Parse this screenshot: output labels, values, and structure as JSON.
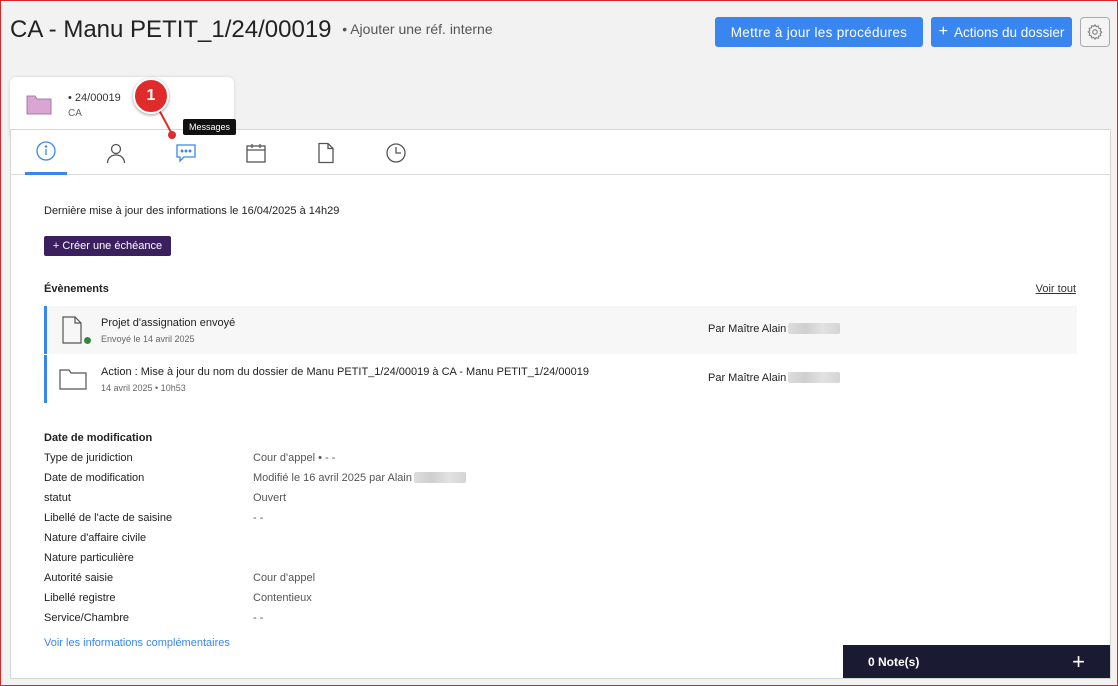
{
  "header": {
    "title": "CA - Manu PETIT_1/24/00019",
    "ref_link": "• Ajouter une réf. interne",
    "update_button": "Mettre à jour les procédures",
    "actions_button": "Actions du dossier",
    "actions_plus": "+"
  },
  "file_tab": {
    "number": "• 24/00019",
    "sub": "CA",
    "folder_color": "#d9a5d2"
  },
  "annotation": {
    "number": "1",
    "color": "#e02b2b"
  },
  "tooltip": {
    "text": "Messages"
  },
  "tabs": [
    {
      "icon": "info-icon",
      "active": true
    },
    {
      "icon": "person-icon"
    },
    {
      "icon": "message-icon"
    },
    {
      "icon": "calendar-icon"
    },
    {
      "icon": "document-icon"
    },
    {
      "icon": "clock-icon"
    }
  ],
  "info": {
    "last_update": "Dernière mise à jour des informations le 16/04/2025 à 14h29",
    "create_button": "+ Créer une échéance"
  },
  "events": {
    "title": "Évènements",
    "see_all": "Voir tout",
    "items": [
      {
        "icon": "document-icon",
        "title": "Projet d'assignation envoyé",
        "subtitle": "Envoyé le 14 avril 2025",
        "by": "Par Maître Alain"
      },
      {
        "icon": "folder-icon",
        "title": "Action : Mise à jour du nom du dossier de Manu PETIT_1/24/00019 à CA - Manu PETIT_1/24/00019",
        "subtitle": "14 avril 2025 • 10h53",
        "by": "Par Maître Alain"
      }
    ]
  },
  "modification": {
    "title": "Date de modification",
    "rows": [
      {
        "key": "Type de juridiction",
        "value": "Cour d'appel • - -"
      },
      {
        "key": "Date de modification",
        "value": "Modifié le 16 avril 2025 par Alain"
      },
      {
        "key": "statut",
        "value": "Ouvert"
      },
      {
        "key": "Libellé de l'acte de saisine",
        "value": "- -"
      },
      {
        "key": "Nature d'affaire civile",
        "value": ""
      },
      {
        "key": "Nature particulière",
        "value": ""
      },
      {
        "key": "Autorité saisie",
        "value": "Cour d'appel"
      },
      {
        "key": "Libellé registre",
        "value": "Contentieux"
      },
      {
        "key": "Service/Chambre",
        "value": "- -"
      }
    ],
    "more_link": "Voir les informations complémentaires"
  },
  "notes": {
    "label": "0 Note(s)",
    "plus": "+"
  },
  "colors": {
    "accent": "#3a86f0",
    "purple": "#3b1f5f",
    "notes_bg": "#1b1a33",
    "status_green": "#2d8a3a"
  }
}
